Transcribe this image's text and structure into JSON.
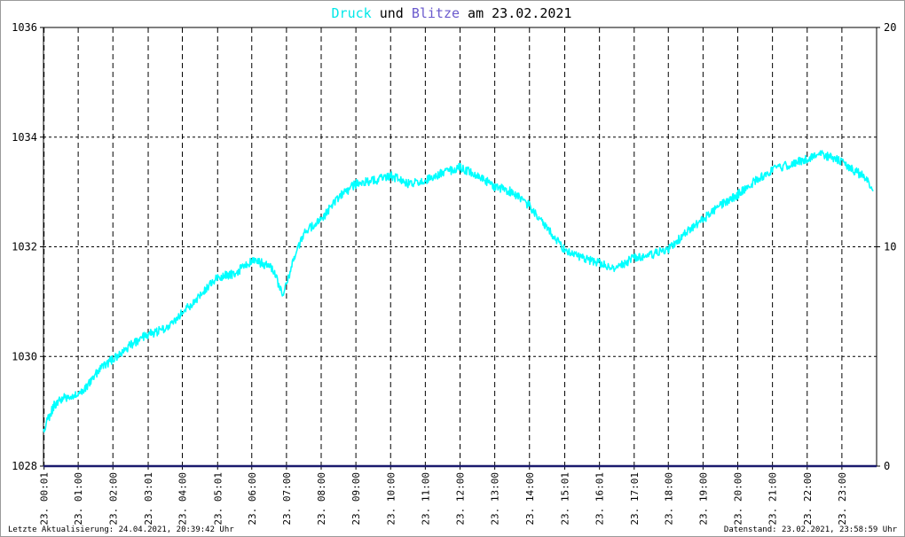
{
  "chart_data": {
    "type": "line",
    "title_parts": [
      {
        "text": "Druck",
        "color": "#00e8e8"
      },
      {
        "text": " und ",
        "color": "#000000"
      },
      {
        "text": "Blitze",
        "color": "#6a5acd"
      },
      {
        "text": " am 23.02.2021",
        "color": "#000000"
      }
    ],
    "y_left": {
      "min": 1028,
      "max": 1036,
      "ticks": [
        "1028",
        "1030",
        "1032",
        "1034",
        "1036"
      ]
    },
    "y_right": {
      "min": 0,
      "max": 20,
      "ticks": [
        "0",
        "10",
        "20"
      ]
    },
    "x_range": [
      0,
      24
    ],
    "x_ticks": [
      {
        "t": 0.0167,
        "label": "23. 00:01"
      },
      {
        "t": 1.0,
        "label": "23. 01:00"
      },
      {
        "t": 2.0,
        "label": "23. 02:00"
      },
      {
        "t": 3.0167,
        "label": "23. 03:01"
      },
      {
        "t": 4.0,
        "label": "23. 04:00"
      },
      {
        "t": 5.0167,
        "label": "23. 05:01"
      },
      {
        "t": 6.0,
        "label": "23. 06:00"
      },
      {
        "t": 7.0,
        "label": "23. 07:00"
      },
      {
        "t": 8.0,
        "label": "23. 08:00"
      },
      {
        "t": 9.0,
        "label": "23. 09:00"
      },
      {
        "t": 10.0,
        "label": "23. 10:00"
      },
      {
        "t": 11.0,
        "label": "23. 11:00"
      },
      {
        "t": 12.0,
        "label": "23. 12:00"
      },
      {
        "t": 13.0,
        "label": "23. 13:00"
      },
      {
        "t": 14.0,
        "label": "23. 14:00"
      },
      {
        "t": 15.0167,
        "label": "23. 15:01"
      },
      {
        "t": 16.0167,
        "label": "23. 16:01"
      },
      {
        "t": 17.0167,
        "label": "23. 17:01"
      },
      {
        "t": 18.0,
        "label": "23. 18:00"
      },
      {
        "t": 19.0,
        "label": "23. 19:00"
      },
      {
        "t": 20.0,
        "label": "23. 20:00"
      },
      {
        "t": 21.0,
        "label": "23. 21:00"
      },
      {
        "t": 22.0,
        "label": "23. 22:00"
      },
      {
        "t": 23.0,
        "label": "23. 23:00"
      }
    ],
    "series": [
      {
        "name": "Druck",
        "color": "#00ffff",
        "x": [
          0.0,
          0.3,
          0.6,
          1.0,
          1.3,
          1.6,
          2.0,
          2.5,
          3.0,
          3.5,
          4.0,
          4.5,
          5.0,
          5.5,
          6.0,
          6.3,
          6.6,
          6.9,
          7.2,
          7.5,
          8.0,
          8.5,
          9.0,
          9.5,
          10.0,
          10.5,
          11.0,
          11.5,
          12.0,
          12.5,
          13.0,
          13.5,
          14.0,
          14.5,
          15.0,
          15.5,
          16.0,
          16.5,
          17.0,
          17.5,
          18.0,
          18.5,
          19.0,
          19.5,
          20.0,
          20.5,
          21.0,
          21.5,
          22.0,
          22.3,
          22.6,
          23.0,
          23.3,
          23.6,
          23.9
        ],
        "values": [
          1028.65,
          1029.1,
          1029.25,
          1029.3,
          1029.5,
          1029.75,
          1029.95,
          1030.2,
          1030.4,
          1030.5,
          1030.8,
          1031.1,
          1031.45,
          1031.5,
          1031.75,
          1031.7,
          1031.6,
          1031.1,
          1031.75,
          1032.25,
          1032.5,
          1032.9,
          1033.15,
          1033.2,
          1033.3,
          1033.15,
          1033.2,
          1033.35,
          1033.45,
          1033.3,
          1033.1,
          1033.0,
          1032.75,
          1032.35,
          1031.95,
          1031.8,
          1031.7,
          1031.6,
          1031.8,
          1031.85,
          1031.95,
          1032.25,
          1032.5,
          1032.75,
          1032.95,
          1033.2,
          1033.4,
          1033.5,
          1033.6,
          1033.7,
          1033.65,
          1033.55,
          1033.4,
          1033.3,
          1033.05
        ],
        "noise": 0.08
      },
      {
        "name": "Blitze",
        "color": "#1a1a6e",
        "axis": "right",
        "x": [
          0,
          24
        ],
        "values": [
          0,
          0
        ]
      }
    ],
    "grid": true
  },
  "footer": {
    "left": "Letzte Aktualisierung: 24.04.2021, 20:39:42 Uhr",
    "right": "Datenstand: 23.02.2021, 23:58:59 Uhr"
  }
}
